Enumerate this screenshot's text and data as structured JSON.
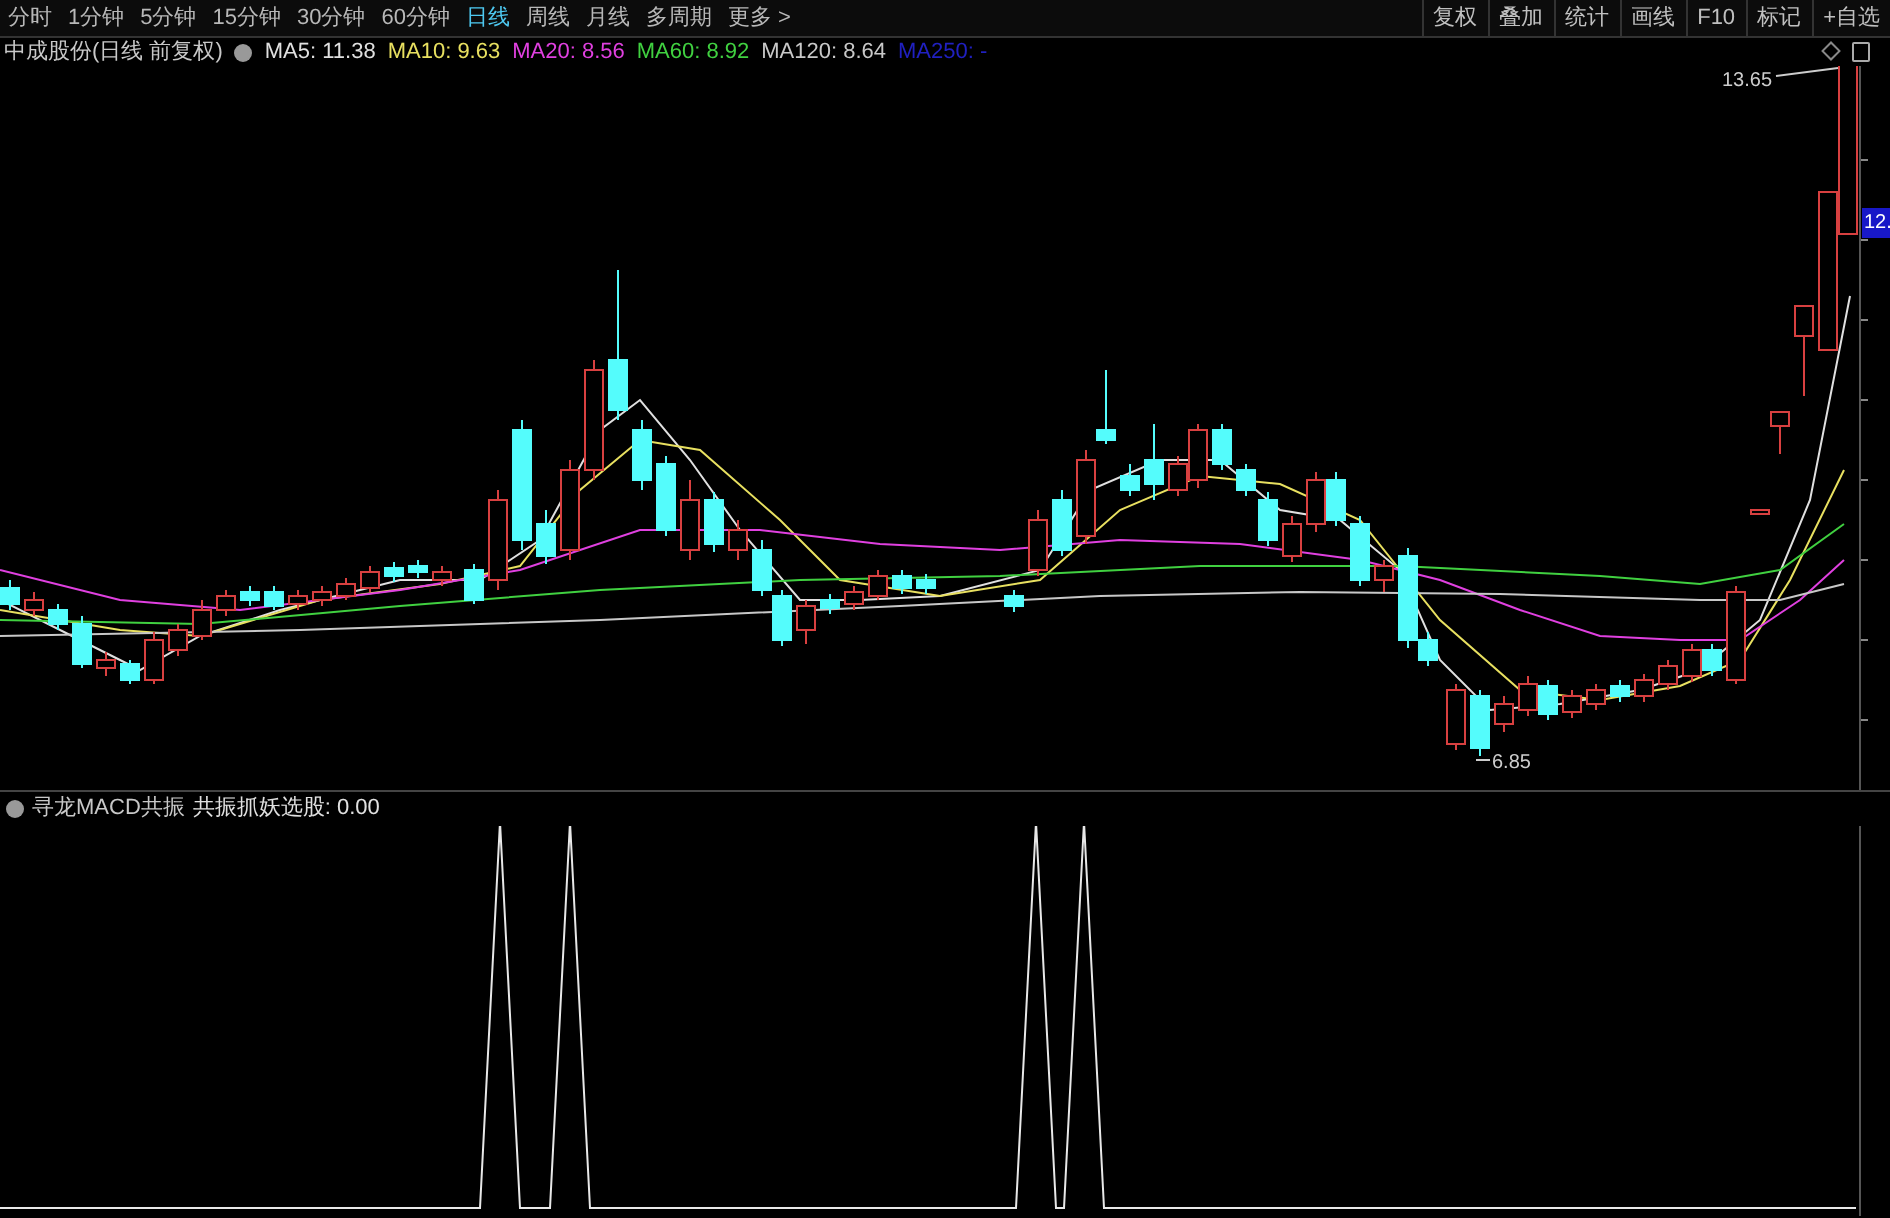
{
  "toolbar": {
    "periods": [
      {
        "label": "分时",
        "selected": false
      },
      {
        "label": "1分钟",
        "selected": false
      },
      {
        "label": "5分钟",
        "selected": false
      },
      {
        "label": "15分钟",
        "selected": false
      },
      {
        "label": "30分钟",
        "selected": false
      },
      {
        "label": "60分钟",
        "selected": false
      },
      {
        "label": "日线",
        "selected": true
      },
      {
        "label": "周线",
        "selected": false
      },
      {
        "label": "月线",
        "selected": false
      },
      {
        "label": "多周期",
        "selected": false
      },
      {
        "label": "更多 >",
        "selected": false
      }
    ],
    "buttons": [
      "复权",
      "叠加",
      "统计",
      "画线",
      "F10",
      "标记",
      "+自选"
    ]
  },
  "chart": {
    "title": "中成股份(日线 前复权)",
    "moving_averages": [
      {
        "label": "MA5: 11.38",
        "color": "#e0e0e0"
      },
      {
        "label": "MA10: 9.63",
        "color": "#e8e060"
      },
      {
        "label": "MA20: 8.56",
        "color": "#e040e0"
      },
      {
        "label": "MA60: 8.92",
        "color": "#40d040"
      },
      {
        "label": "MA120: 8.64",
        "color": "#c8c8c8"
      },
      {
        "label": "MA250: -",
        "color": "#2020c0"
      }
    ],
    "high_label": "13.65",
    "low_label": "6.85",
    "price_badge": "12."
  },
  "indicator": {
    "name": "寻龙MACD共振",
    "reading": "共振抓妖选股: 0.00"
  }
}
